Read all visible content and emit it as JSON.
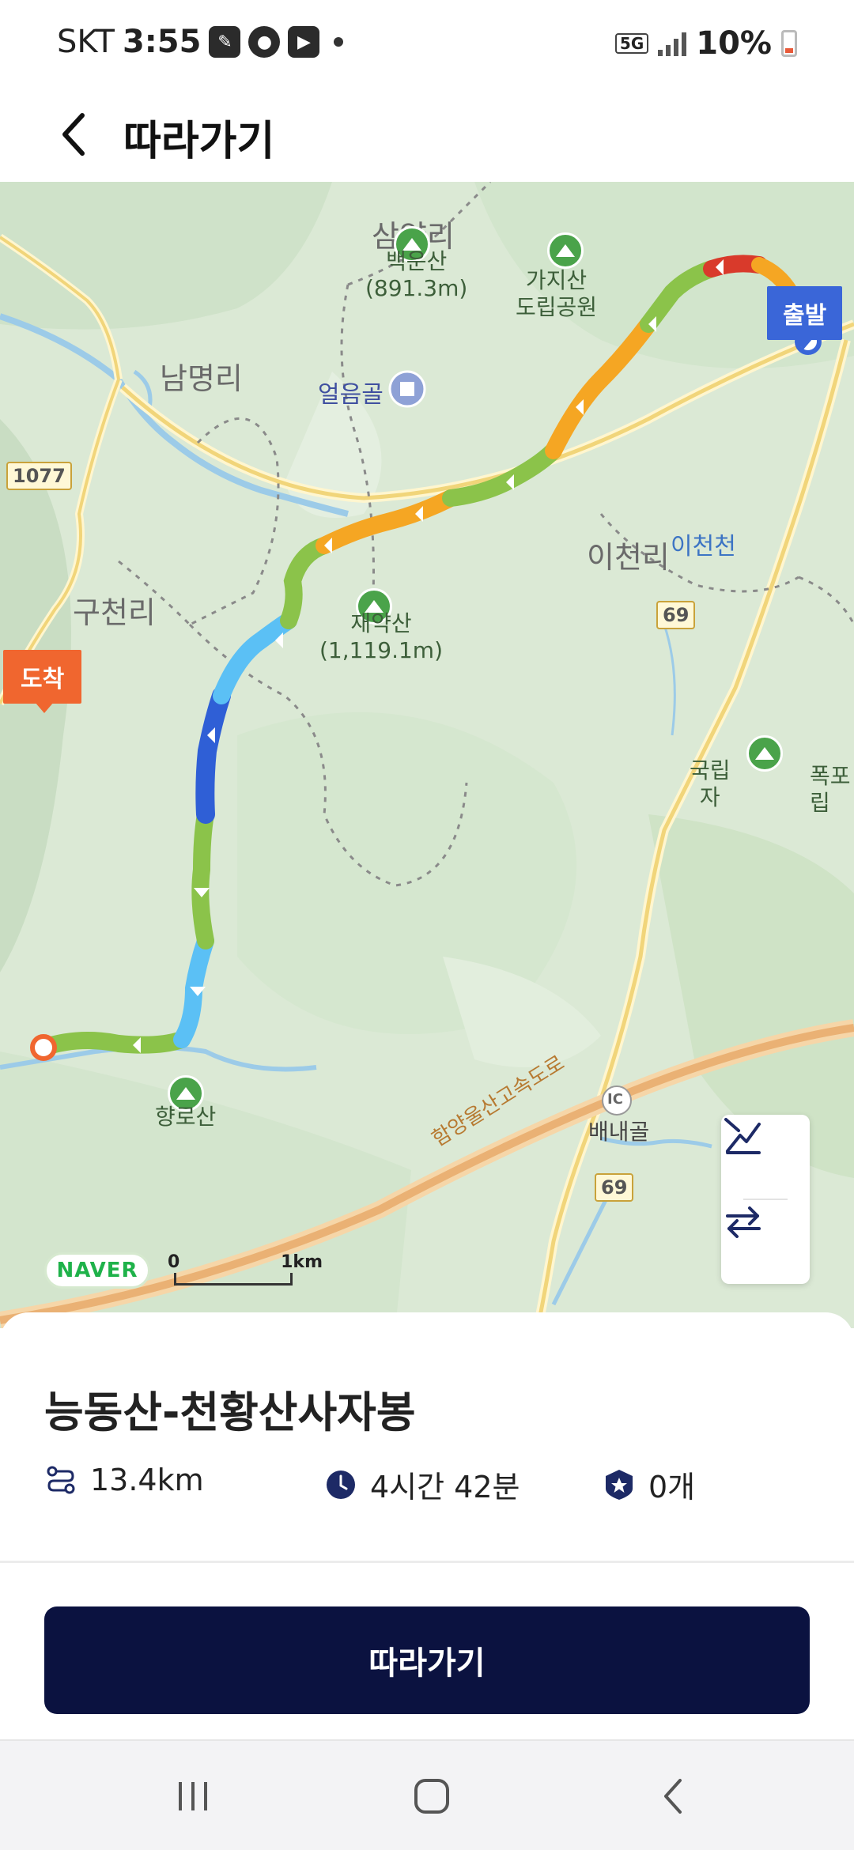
{
  "status_bar": {
    "carrier": "SKT",
    "time": "3:55",
    "network": "5G",
    "battery": "10%",
    "notification_icons": [
      "messaging-app-icon",
      "chat-bubble-icon",
      "youtube-icon"
    ]
  },
  "header": {
    "title": "따라가기",
    "back_icon": "chevron-left-icon"
  },
  "map": {
    "places": {
      "samyangri": "삼양리",
      "nammyeongri": "남명리",
      "gucheonri": "구천리",
      "icheonri": "이천리",
      "icheoncheon": "이천천",
      "eoreumgol": "얼음골",
      "baenaegol": "배내골"
    },
    "mountains": {
      "gajisan_park": "가지산\n도립공원",
      "baegunsan": "백운산\n(891.3m)",
      "jaeyaksan": "재약산\n(1,119.1m)",
      "hangdosan": "향로산",
      "national_park_partial": "국립\n자"
    },
    "right_edge_text": {
      "falls": "폭포",
      "park": "립"
    },
    "expressway": "함양울산고속도로",
    "interchange": "IC",
    "road_numbers": [
      "1077",
      "69",
      "69"
    ],
    "start_marker": "출발",
    "end_marker": "도착",
    "naver_logo": "NAVER",
    "scale": {
      "start": "0",
      "end": "1km"
    },
    "controls": {
      "elevation_icon": "elevation-chart-icon",
      "swap_icon": "swap-direction-icon"
    },
    "colors": {
      "route_green": "#8bc34a",
      "route_orange": "#f5a623",
      "route_lightblue": "#5bc0f5",
      "route_darkblue": "#2f5fd6",
      "route_red": "#d93a2b"
    }
  },
  "route": {
    "name": "능동산-천황산사자봉",
    "distance": "13.4km",
    "duration": "4시간 42분",
    "count": "0개",
    "icons": [
      "route-distance-icon",
      "clock-icon",
      "badge-star-icon"
    ]
  },
  "actions": {
    "follow": "따라가기"
  },
  "nav_bar": {
    "icons": [
      "recent-apps-icon",
      "home-icon",
      "back-icon"
    ]
  }
}
